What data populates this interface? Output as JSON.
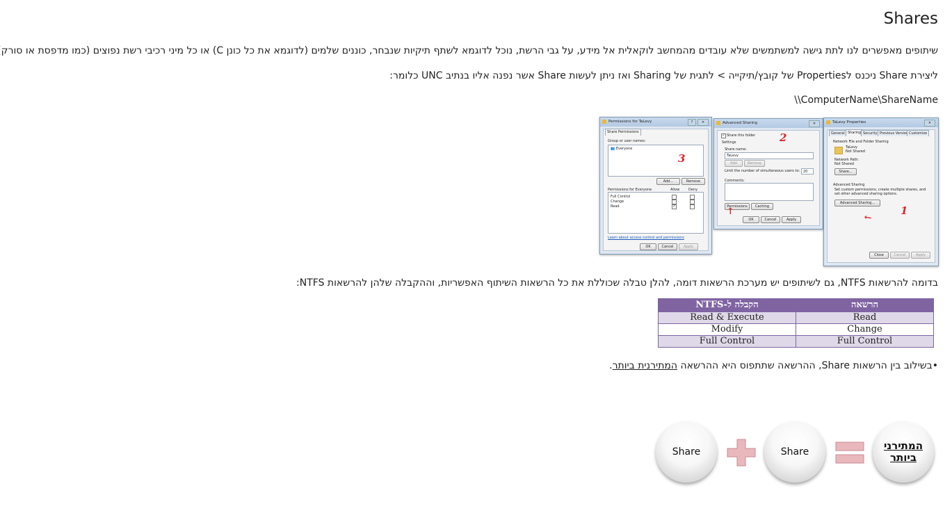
{
  "title": "Shares",
  "paragraphs": {
    "p1": "שיתופים מאפשרים לנו לתת גישה למשתמשים שלא עובדים מהמחשב לוקאלית אל מידע, על גבי הרשת, נוכל לדוגמא לשתף תיקיות שנבחר, כוננים שלמים (לדוגמא את כל כונן C) או כל מיני רכיבי רשת נפוצים (כמו מדפסת או סורק)",
    "p2": "ליצירת Share ניכנס לProperties של קובץ/תיקייה > לתגית של Sharing ואז ניתן לעשות Share אשר נפנה אליו בנתיב UNC כלומר:",
    "p3": "\\\\ComputerName\\ShareName",
    "p4": "בדומה להרשאות NTFS, גם לשיתופים יש מערכת הרשאות דומה, להלן טבלה שכוללת את כל הרשאות השיתוף האפשריות, וההקבלה שלהן להרשאות NTFS:",
    "p5_prefix": "•בשילוב בין הרשאות Share, ההרשאה שתתפוס היא ההרשאה ",
    "p5_underlined": "המתירנית ביותר",
    "p5_suffix": "."
  },
  "screenshot": {
    "permissions_window": {
      "title": "Permissions for TaLevy",
      "tab": "Share Permissions",
      "group_label": "Group or user names:",
      "group_item": "Everyone",
      "add": "Add...",
      "remove": "Remove",
      "perm_label": "Permissions for Everyone",
      "allow": "Allow",
      "deny": "Deny",
      "perms": [
        "Full Control",
        "Change",
        "Read"
      ],
      "link": "Learn about access control and permissions",
      "ok": "OK",
      "cancel": "Cancel",
      "apply": "Apply"
    },
    "advanced_window": {
      "title": "Advanced Sharing",
      "share_this_folder": "Share this folder",
      "settings": "Settings",
      "share_name_label": "Share name:",
      "share_name_value": "TaLevy",
      "add": "Add",
      "remove": "Remove",
      "limit_label": "Limit the number of simultaneous users to:",
      "limit_value": "20",
      "comments": "Comments:",
      "permissions": "Permissions",
      "caching": "Caching",
      "ok": "OK",
      "cancel": "Cancel",
      "apply": "Apply"
    },
    "properties_window": {
      "title": "TaLevy Properties",
      "tabs": [
        "General",
        "Sharing",
        "Security",
        "Previous Versions",
        "Customize"
      ],
      "nf_sharing": "Network File and Folder Sharing",
      "folder_name": "TaLevy",
      "not_shared": "Not Shared",
      "network_path_label": "Network Path:",
      "network_path_value": "Not Shared",
      "share_btn": "Share...",
      "adv_sharing": "Advanced Sharing",
      "adv_desc": "Set custom permissions, create multiple shares, and set other advanced sharing options.",
      "adv_btn": "Advanced Sharing...",
      "close": "Close",
      "cancel": "Cancel",
      "apply": "Apply"
    },
    "annotations": [
      "1",
      "2",
      "3"
    ]
  },
  "table": {
    "headers": [
      "הרשאה",
      "הקבלה ל-NTFS"
    ],
    "rows": [
      [
        "Read",
        "Read & Execute"
      ],
      [
        "Change",
        "Modify"
      ],
      [
        "Full Control",
        "Full Control"
      ]
    ]
  },
  "diagram": {
    "result_label": "המתירני ביותר",
    "operand1": "Share",
    "operand2": "Share",
    "colors": {
      "operator": "#e9b8bd",
      "operator_border": "#c98a91"
    }
  }
}
